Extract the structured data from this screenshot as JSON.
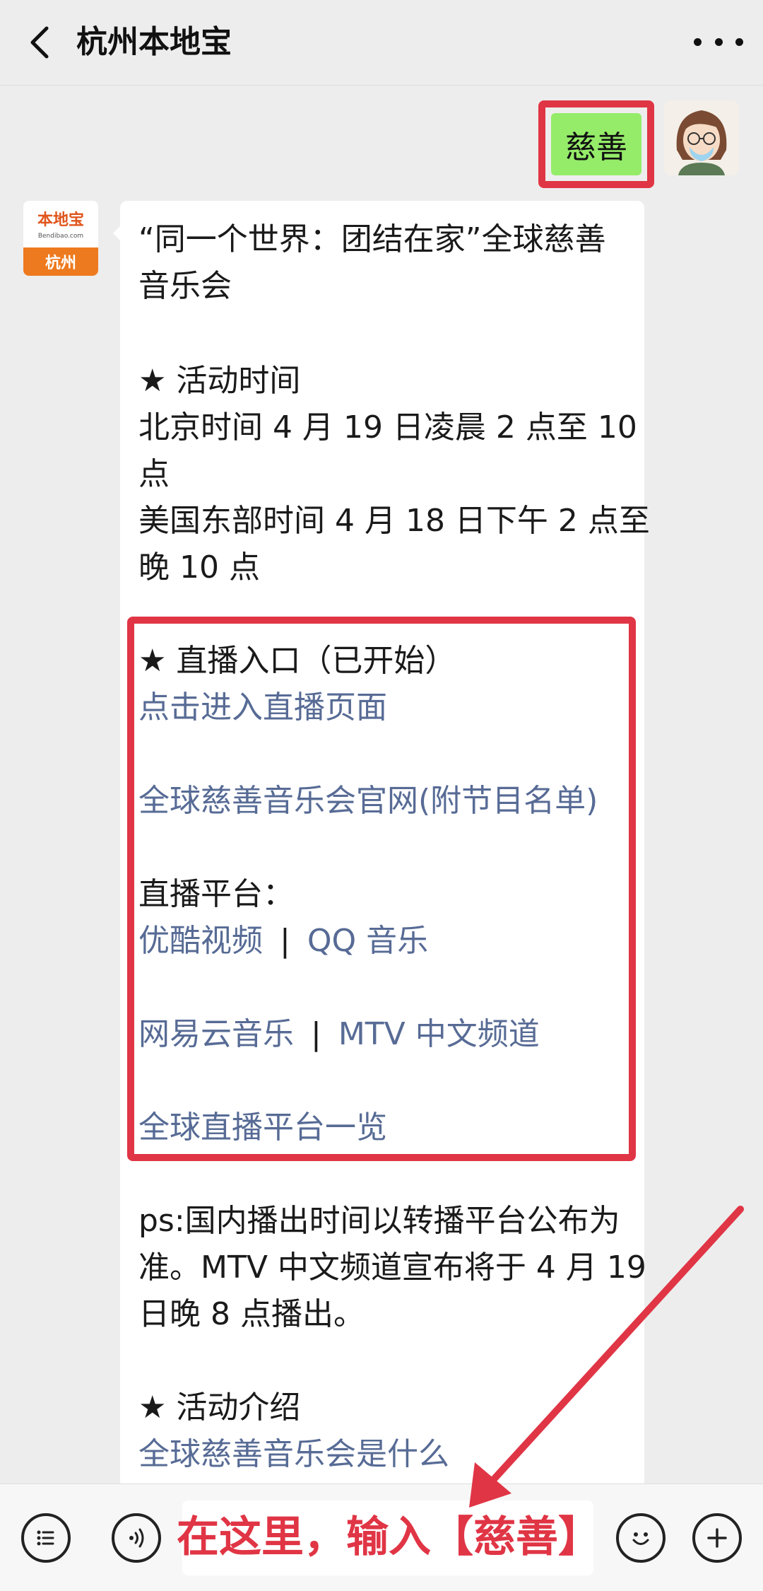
{
  "header": {
    "title": "杭州本地宝"
  },
  "sent": {
    "text": "慈善"
  },
  "bot_avatar": {
    "line1": "本地宝",
    "line2": "Bendibao.com",
    "line3": "杭州"
  },
  "message": {
    "l1": "“同一个世界：团结在家”全球慈善",
    "l2": "音乐会",
    "l3": "★ 活动时间",
    "l4": "北京时间 4 月 19 日凌晨 2 点至 10",
    "l5": "点",
    "l6": "美国东部时间 4 月 18 日下午 2 点至",
    "l7": "晚 10 点",
    "l8": "★ 直播入口（已开始）",
    "link1": "点击进入直播页面",
    "link2": "全球慈善音乐会官网(附节目名单)",
    "l9": "直播平台：",
    "link3": "优酷视频",
    "sep": "|",
    "link4": "QQ 音乐",
    "link5": "网易云音乐",
    "link6": "MTV 中文频道",
    "link7": "全球直播平台一览",
    "l10": "ps:国内播出时间以转播平台公布为",
    "l11": "准。MTV 中文频道宣布将于 4 月 19",
    "l12": "日晚 8 点播出。",
    "l13": "★ 活动介绍",
    "link8": "全球慈善音乐会是什么"
  },
  "input": {
    "annotation": "在这里，输入【慈善】"
  },
  "colors": {
    "link": "#576b95",
    "highlight": "#e03545",
    "sent_bubble": "#95ec69"
  }
}
